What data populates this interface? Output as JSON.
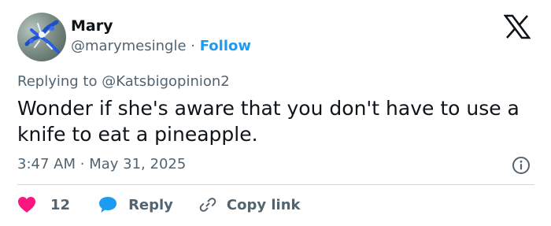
{
  "author": {
    "name": "Mary",
    "handle": "@marymesingle",
    "separator": "·",
    "follow_label": "Follow"
  },
  "reply_context": {
    "prefix": "Replying to",
    "mention": "@Katsbigopinion2"
  },
  "tweet": {
    "text": "Wonder if she's aware that you don't have to use a knife to eat a pineapple.",
    "time": "3:47 AM",
    "separator": "·",
    "date": "May 31, 2025"
  },
  "actions": {
    "like_count": "12",
    "reply_label": "Reply",
    "copy_link_label": "Copy link"
  },
  "icons": {
    "brand": "x-logo-icon",
    "info": "info-icon",
    "like": "heart-icon",
    "reply": "speech-bubble-icon",
    "copy": "link-icon"
  },
  "colors": {
    "link_blue": "#1d9bf0",
    "secondary_text": "#536471",
    "heart_pink": "#f91880",
    "divider": "#cfd9de"
  }
}
